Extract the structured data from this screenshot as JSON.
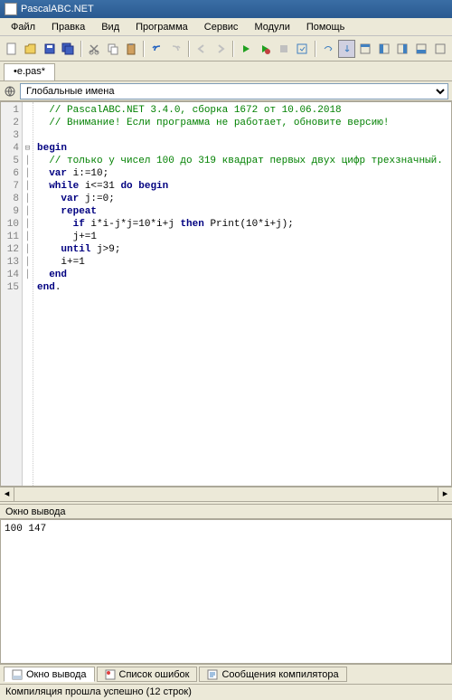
{
  "title": "PascalABC.NET",
  "menu": [
    "Файл",
    "Правка",
    "Вид",
    "Программа",
    "Сервис",
    "Модули",
    "Помощь"
  ],
  "file_tab": "•e.pas*",
  "nav_dropdown": "Глобальные имена",
  "code_lines": [
    {
      "n": 1,
      "fold": "",
      "type": "comment",
      "text": "  // PascalABC.NET 3.4.0, сборка 1672 от 10.06.2018"
    },
    {
      "n": 2,
      "fold": "",
      "type": "comment",
      "text": "  // Внимание! Если программа не работает, обновите версию!"
    },
    {
      "n": 3,
      "fold": "",
      "type": "plain",
      "text": ""
    },
    {
      "n": 4,
      "fold": "⊟",
      "type": "keyword",
      "text": "begin"
    },
    {
      "n": 5,
      "fold": "│",
      "type": "comment",
      "text": "  // только у чисел 100 до 319 квадрат первых двух цифр трехзначный."
    },
    {
      "n": 6,
      "fold": "│",
      "type": "code",
      "parts": [
        {
          "t": "  "
        },
        {
          "t": "var",
          "k": true
        },
        {
          "t": " i:=10;"
        }
      ]
    },
    {
      "n": 7,
      "fold": "│",
      "type": "code",
      "parts": [
        {
          "t": "  "
        },
        {
          "t": "while",
          "k": true
        },
        {
          "t": " i<=31 "
        },
        {
          "t": "do begin",
          "k": true
        }
      ]
    },
    {
      "n": 8,
      "fold": "│",
      "type": "code",
      "parts": [
        {
          "t": "    "
        },
        {
          "t": "var",
          "k": true
        },
        {
          "t": " j:=0;"
        }
      ]
    },
    {
      "n": 9,
      "fold": "│",
      "type": "code",
      "parts": [
        {
          "t": "    "
        },
        {
          "t": "repeat",
          "k": true
        }
      ]
    },
    {
      "n": 10,
      "fold": "│",
      "type": "code",
      "parts": [
        {
          "t": "      "
        },
        {
          "t": "if",
          "k": true
        },
        {
          "t": " i*i-j*j=10*i+j "
        },
        {
          "t": "then",
          "k": true
        },
        {
          "t": " Print(10*i+j);"
        }
      ]
    },
    {
      "n": 11,
      "fold": "│",
      "type": "plain",
      "text": "      j+=1"
    },
    {
      "n": 12,
      "fold": "│",
      "type": "code",
      "parts": [
        {
          "t": "    "
        },
        {
          "t": "until",
          "k": true
        },
        {
          "t": " j>9;"
        }
      ]
    },
    {
      "n": 13,
      "fold": "│",
      "type": "plain",
      "text": "    i+=1"
    },
    {
      "n": 14,
      "fold": "│",
      "type": "code",
      "parts": [
        {
          "t": "  "
        },
        {
          "t": "end",
          "k": true
        }
      ]
    },
    {
      "n": 15,
      "fold": "",
      "type": "code",
      "parts": [
        {
          "t": "end",
          "k": true
        },
        {
          "t": "."
        }
      ]
    }
  ],
  "output_header": "Окно вывода",
  "output_text": "100 147",
  "bottom_tabs": [
    {
      "label": "Окно вывода",
      "active": true,
      "icon": "output"
    },
    {
      "label": "Список ошибок",
      "active": false,
      "icon": "errors"
    },
    {
      "label": "Сообщения компилятора",
      "active": false,
      "icon": "compiler"
    }
  ],
  "status": "Компиляция прошла успешно (12 строк)"
}
